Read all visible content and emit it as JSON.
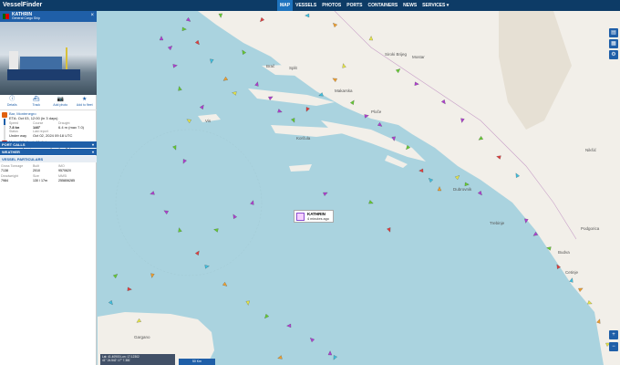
{
  "topbar": {
    "logo": "VesselFinder",
    "nav": [
      "MAP",
      "VESSELS",
      "PHOTOS",
      "PORTS",
      "CONTAINERS",
      "NEWS",
      "SERVICES ▾"
    ]
  },
  "vessel": {
    "name": "KATHRIN",
    "type": "General Cargo Ship",
    "close": "×",
    "actions": [
      {
        "label": "Details",
        "icon": "info-icon",
        "glyph": "ⓘ"
      },
      {
        "label": "Track",
        "icon": "track-icon",
        "glyph": "⛴"
      },
      {
        "label": "Add photo",
        "icon": "camera-icon",
        "glyph": "📷"
      },
      {
        "label": "Add to fleet",
        "icon": "star-icon",
        "glyph": "★"
      }
    ],
    "departure": {
      "port": "Bar, Montenegro",
      "atd": "ETA: Oct 03, 12:00 (in 3 days)"
    },
    "speed_label": "Speed",
    "speed": "7.8 kn",
    "course_label": "Course",
    "course": "146°",
    "draught_label": "Draught",
    "draught": "6.4 m (max 7.0)",
    "status_label": "Status",
    "status": "Under way",
    "lastreport_label": "Last report",
    "lastreport": "Oct 02, 2024 09:18 UTC",
    "arrival": {
      "port": "Malta (Mh Anch, Malta)",
      "ata": "ATD: Sep 28, 09:42 UTC (5 days ago)"
    },
    "progress": 0.3
  },
  "sections": {
    "port_calls": "PORT CALLS",
    "weather": "WEATHER",
    "particulars": "VESSEL PARTICULARS"
  },
  "particulars": [
    {
      "label": "Gross Tonnage",
      "value": "7138"
    },
    {
      "label": "Built",
      "value": "2010"
    },
    {
      "label": "IMO",
      "value": "9570620"
    },
    {
      "label": "Deadweight",
      "value": "7984"
    },
    {
      "label": "Size",
      "value": "130 / 17m"
    },
    {
      "label": "MMSI",
      "value": "255806285"
    }
  ],
  "map": {
    "tooltip_name": "KATHRIN",
    "tooltip_time": "4 minutes ago",
    "places": [
      "Split",
      "Mostar",
      "Brač",
      "Trebinje",
      "Dubrovnik",
      "Korčula",
      "Nikšić",
      "Budva",
      "Cetinje",
      "Podgorica",
      "Vis",
      "Gargano",
      "Siroki Brijeg",
      "Makarska",
      "Ploče"
    ],
    "coords_line1": "Lat: 41.40903  Lon: 17.12302",
    "coords_line2": "41° 24.542'  17° 7.381'",
    "scale": "50 Km",
    "colors": {
      "sea": "#aad3df",
      "land": "#f2efe9",
      "cargo": "#66cc33",
      "tanker": "#e04040",
      "passenger": "#b040d0",
      "tug": "#40c0e0",
      "fishing": "#f0a030",
      "pleasure": "#e6e64a"
    }
  },
  "controls": {
    "zoom_in": "+",
    "zoom_out": "−"
  }
}
